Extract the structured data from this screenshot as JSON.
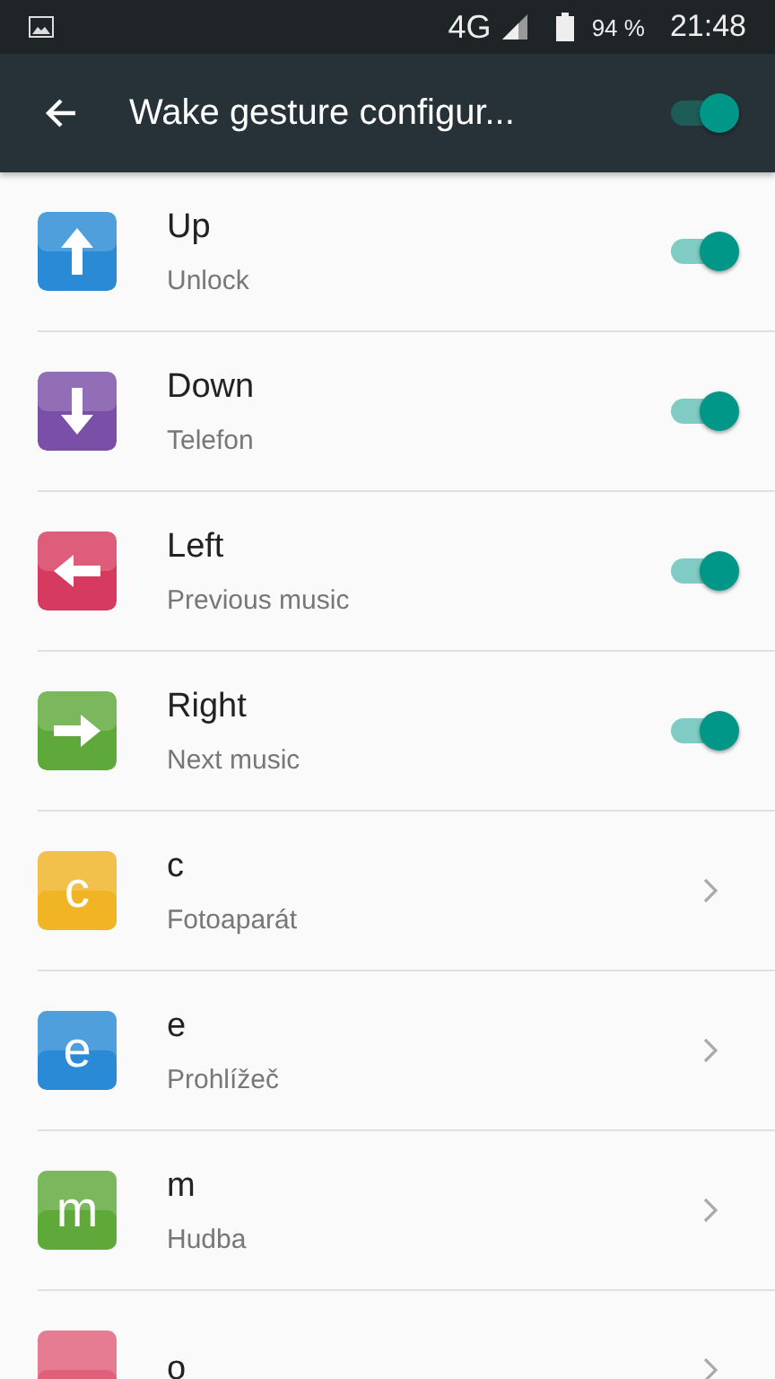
{
  "status_bar": {
    "network": "4G",
    "battery": "94 %",
    "time": "21:48"
  },
  "toolbar": {
    "title": "Wake gesture configur...",
    "on": true
  },
  "items": [
    {
      "kind": "toggle",
      "title": "Up",
      "subtitle": "Unlock",
      "on": true,
      "icon": {
        "kind": "arrow_up",
        "color": "#2a8ad6"
      }
    },
    {
      "kind": "toggle",
      "title": "Down",
      "subtitle": "Telefon",
      "on": true,
      "icon": {
        "kind": "arrow_down",
        "color": "#7a4fa8"
      }
    },
    {
      "kind": "toggle",
      "title": "Left",
      "subtitle": "Previous music",
      "on": true,
      "icon": {
        "kind": "arrow_left",
        "color": "#d63a5e"
      }
    },
    {
      "kind": "toggle",
      "title": "Right",
      "subtitle": "Next music",
      "on": true,
      "icon": {
        "kind": "arrow_right",
        "color": "#5fa83a"
      }
    },
    {
      "kind": "link",
      "title": "c",
      "subtitle": "Fotoaparát",
      "icon": {
        "kind": "letter",
        "glyph": "c",
        "color": "#f0b424"
      }
    },
    {
      "kind": "link",
      "title": "e",
      "subtitle": "Prohlížeč",
      "icon": {
        "kind": "letter",
        "glyph": "e",
        "color": "#2a8ad6"
      }
    },
    {
      "kind": "link",
      "title": "m",
      "subtitle": "Hudba",
      "icon": {
        "kind": "letter",
        "glyph": "m",
        "color": "#5fa83a"
      }
    },
    {
      "kind": "link",
      "title": "o",
      "icon": {
        "kind": "letter",
        "color": "#e0607a"
      }
    }
  ]
}
